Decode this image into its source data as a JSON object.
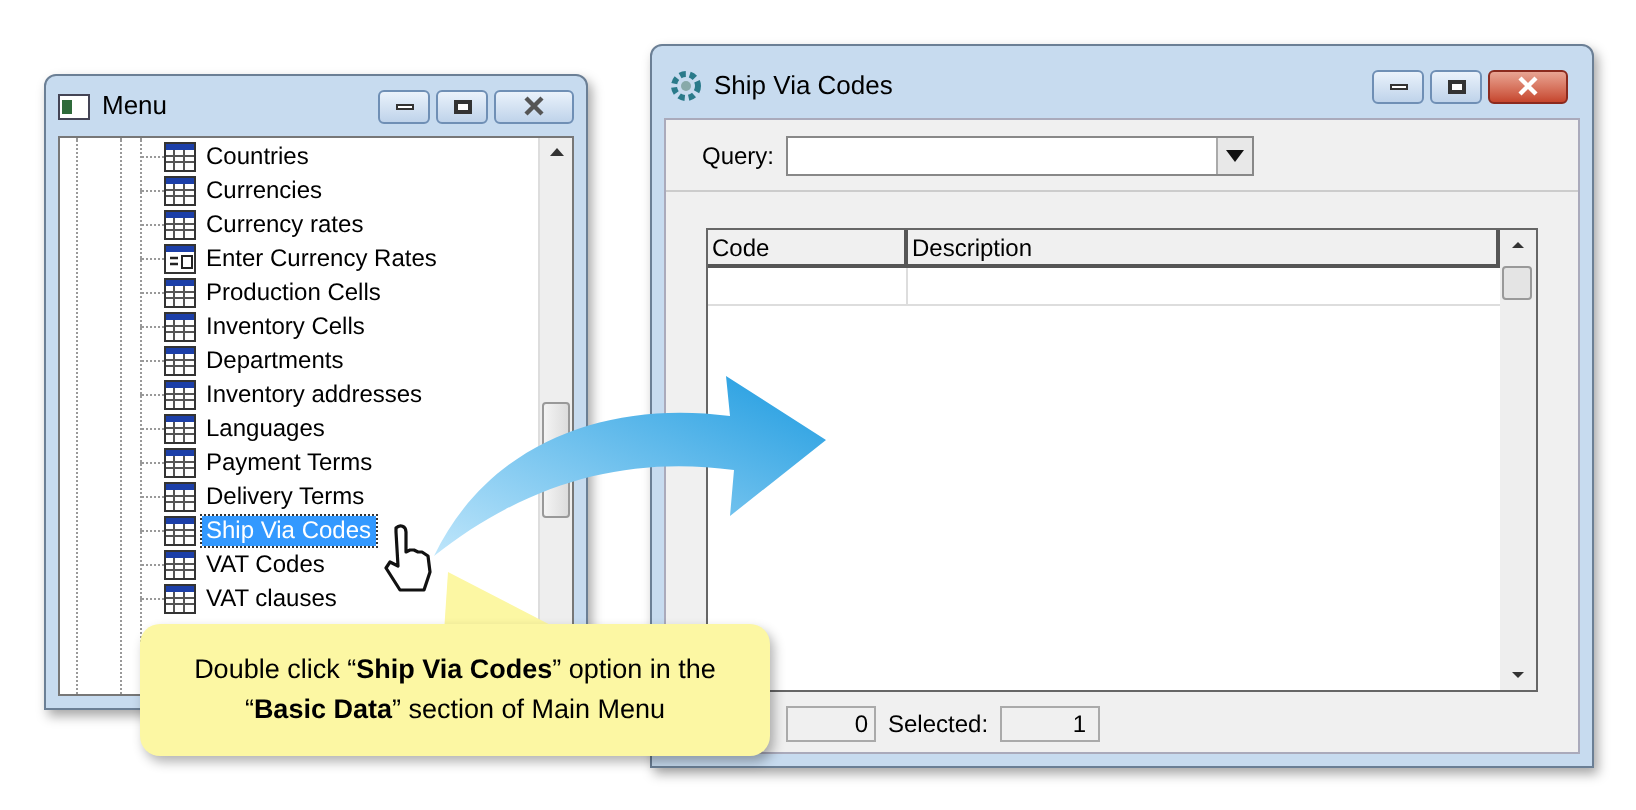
{
  "menu_window": {
    "title": "Menu",
    "items": [
      {
        "label": "Countries",
        "kind": "table",
        "selected": false
      },
      {
        "label": "Currencies",
        "kind": "table",
        "selected": false
      },
      {
        "label": "Currency rates",
        "kind": "table",
        "selected": false
      },
      {
        "label": "Enter Currency Rates",
        "kind": "form",
        "selected": false
      },
      {
        "label": "Production Cells",
        "kind": "table",
        "selected": false
      },
      {
        "label": "Inventory Cells",
        "kind": "table",
        "selected": false
      },
      {
        "label": "Departments",
        "kind": "table",
        "selected": false
      },
      {
        "label": "Inventory addresses",
        "kind": "table",
        "selected": false
      },
      {
        "label": "Languages",
        "kind": "table",
        "selected": false
      },
      {
        "label": "Payment Terms",
        "kind": "table",
        "selected": false
      },
      {
        "label": "Delivery Terms",
        "kind": "table",
        "selected": false
      },
      {
        "label": "Ship Via Codes",
        "kind": "table",
        "selected": true
      },
      {
        "label": "VAT Codes",
        "kind": "table",
        "selected": false
      },
      {
        "label": "VAT clauses",
        "kind": "table",
        "selected": false
      }
    ]
  },
  "ship_via_window": {
    "title": "Ship Via Codes",
    "query_label": "Query:",
    "table": {
      "columns": [
        "Code",
        "Description"
      ]
    },
    "status_bar": {
      "count": "0",
      "selected_label": "Selected:",
      "selected_value": "1"
    }
  },
  "callout": {
    "text": "Double click “**Ship Via Codes**” option in the “**Basic Data**” section of Main Menu"
  }
}
